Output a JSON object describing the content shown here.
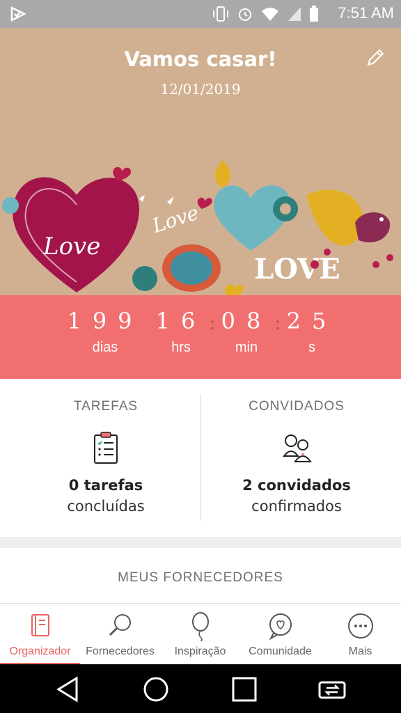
{
  "status_bar": {
    "time": "7:51 AM",
    "icons": [
      "app-logo-icon",
      "vibrate-icon",
      "alarm-icon",
      "wifi-icon",
      "signal-icon",
      "battery-icon"
    ]
  },
  "header": {
    "title": "Vamos casar!",
    "date": "12/01/2019",
    "edit_icon": "pencil-icon"
  },
  "hero_art": {
    "love_labels": [
      "Love",
      "Love",
      "LOVE"
    ]
  },
  "countdown": {
    "days": "199",
    "hours": "16",
    "minutes": "08",
    "seconds": "25",
    "days_label": "dias",
    "hours_label": "hrs",
    "minutes_label": "min",
    "seconds_label": "s",
    "separator": ":"
  },
  "tasks": {
    "heading": "TAREFAS",
    "count": "0 tarefas",
    "sub": "concluídas",
    "icon": "clipboard-checklist-icon"
  },
  "guests": {
    "heading": "CONVIDADOS",
    "count": "2 convidados",
    "sub": "confirmados",
    "icon": "couple-icon"
  },
  "suppliers": {
    "heading": "MEUS FORNECEDORES"
  },
  "tabs": [
    {
      "label": "Organizador",
      "icon": "notebook-icon",
      "active": true
    },
    {
      "label": "Fornecedores",
      "icon": "magnifier-icon",
      "active": false
    },
    {
      "label": "Inspiração",
      "icon": "balloon-icon",
      "active": false
    },
    {
      "label": "Comunidade",
      "icon": "chat-heart-icon",
      "active": false
    },
    {
      "label": "Mais",
      "icon": "more-dots-icon",
      "active": false
    }
  ],
  "colors": {
    "hero_bg": "#d1b092",
    "countdown_bg": "#f16f6f",
    "accent": "#e8645f",
    "status_bar": "#a9a9a9"
  }
}
